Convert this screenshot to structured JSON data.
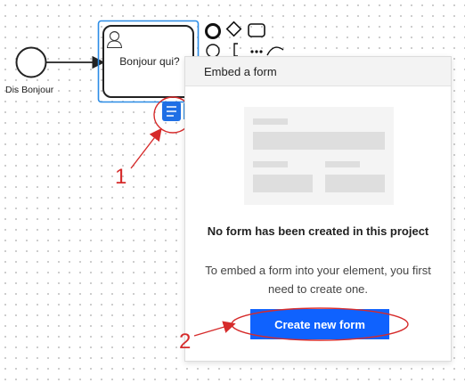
{
  "diagram": {
    "start_event": {
      "label": "Dis Bonjour"
    },
    "user_task": {
      "label": "Bonjour qui?"
    },
    "palette_icons": [
      "end-event-icon",
      "gateway-icon",
      "task-icon",
      "intermediate-event-icon",
      "text-annotation-icon",
      "more-icon",
      "connect-icon"
    ],
    "form_link_icon": "form-icon"
  },
  "annotations": {
    "step_1": "1",
    "step_2": "2",
    "color": "#d62b2b"
  },
  "form_panel": {
    "title": "Embed a form",
    "empty_title": "No form has been created in this project",
    "empty_description": "To embed a form into your element, you first need to create one.",
    "create_button": "Create new form"
  },
  "colors": {
    "selection": "#2b8ce6",
    "primary_button": "#0f62fe",
    "annotation": "#d62b2b"
  }
}
